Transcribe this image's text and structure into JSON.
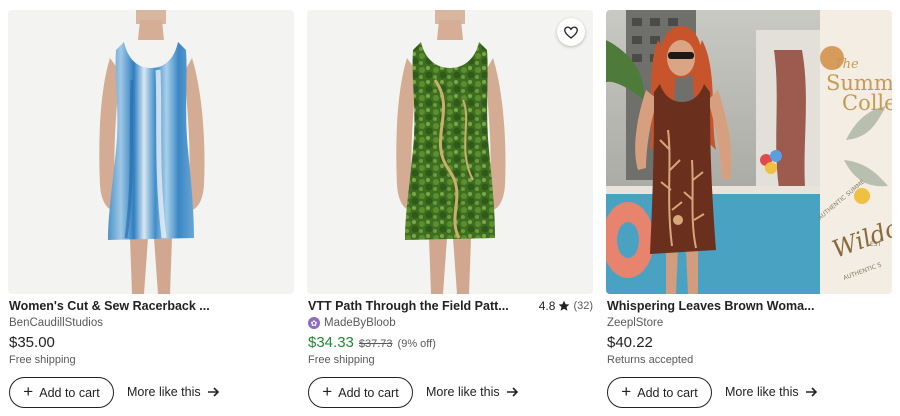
{
  "listings": [
    {
      "title": "Women's Cut & Sew Racerback ...",
      "seller": "BenCaudillStudios",
      "price": "$35.00",
      "note": "Free shipping",
      "add_to_cart_label": "Add to cart",
      "more_like_this_label": "More like this"
    },
    {
      "title": "VTT Path Through the Field Patt...",
      "rating": "4.8",
      "review_count": "(32)",
      "seller": "MadeByBloob",
      "price": "$34.33",
      "original_price": "$37.73",
      "discount": "(9% off)",
      "note": "Free shipping",
      "add_to_cart_label": "Add to cart",
      "more_like_this_label": "More like this"
    },
    {
      "title": "Whispering Leaves Brown Woma...",
      "seller": "ZeeplStore",
      "price": "$40.22",
      "note": "Returns accepted",
      "add_to_cart_label": "Add to cart",
      "more_like_this_label": "More like this"
    }
  ],
  "promo_banner": {
    "text_line1": "The",
    "text_line2": "Summ",
    "text_line3": "Colle",
    "script_text": "Wildch",
    "side_text_1": "AUTHENTIC SUMME",
    "side_text_2": "EST",
    "side_text_3": "AUTHENTIC S"
  },
  "colors": {
    "sale_price": "#258635",
    "text_primary": "#222222",
    "text_secondary": "#595959",
    "star_badge": "#8e6cc3"
  },
  "icons": {
    "favorite": "heart-outline-icon",
    "rating": "star-icon",
    "seller_badge": "star-seller-badge-icon",
    "add": "plus-icon",
    "more": "arrow-right-icon"
  }
}
